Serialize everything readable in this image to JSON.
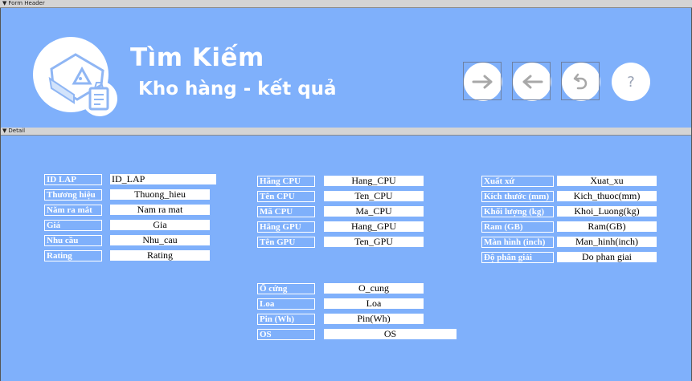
{
  "sections": {
    "header": "Form Header",
    "detail": "Detail"
  },
  "header": {
    "title": "Tìm Kiếm",
    "subtitle": "Kho hàng - kết quả",
    "help_label": "?"
  },
  "left_fields": [
    {
      "label": "ID LAP",
      "value": "ID_LAP"
    },
    {
      "label": "Thương hiệu",
      "value": "Thuong_hieu"
    },
    {
      "label": "Năm ra mắt",
      "value": "Nam ra mat"
    },
    {
      "label": "Giá",
      "value": "Gia"
    },
    {
      "label": "Nhu cầu",
      "value": "Nhu_cau"
    },
    {
      "label": "Rating",
      "value": "Rating"
    }
  ],
  "middle_fields": [
    {
      "label": "Hãng CPU",
      "value": "Hang_CPU"
    },
    {
      "label": "Tên CPU",
      "value": "Ten_CPU"
    },
    {
      "label": "Mã CPU",
      "value": "Ma_CPU"
    },
    {
      "label": "Hãng GPU",
      "value": "Hang_GPU"
    },
    {
      "label": "Tên GPU",
      "value": "Ten_GPU"
    }
  ],
  "bottom_fields": [
    {
      "label": "Ổ cứng",
      "value": "O_cung"
    },
    {
      "label": "Loa",
      "value": "Loa"
    },
    {
      "label": "Pin (Wh)",
      "value": "Pin(Wh)"
    },
    {
      "label": "OS",
      "value": "OS"
    }
  ],
  "right_fields": [
    {
      "label": "Xuất xứ",
      "value": "Xuat_xu"
    },
    {
      "label": "Kích thước (mm)",
      "value": "Kich_thuoc(mm)"
    },
    {
      "label": "Khối lượng (kg)",
      "value": "Khoi_Luong(kg)"
    },
    {
      "label": "Ram (GB)",
      "value": "Ram(GB)"
    },
    {
      "label": "Màn hình (inch)",
      "value": "Man_hinh(inch)"
    },
    {
      "label": "Độ phân giải",
      "value": "Do phan giai"
    }
  ],
  "colors": {
    "background": "#7fb0fb",
    "label_text": "#ffffff",
    "field_bg": "#ffffff"
  },
  "icons": {
    "next": "arrow-right-icon",
    "back": "arrow-left-icon",
    "undo": "undo-icon",
    "help": "help-icon",
    "logo": "warehouse-box-logo"
  }
}
